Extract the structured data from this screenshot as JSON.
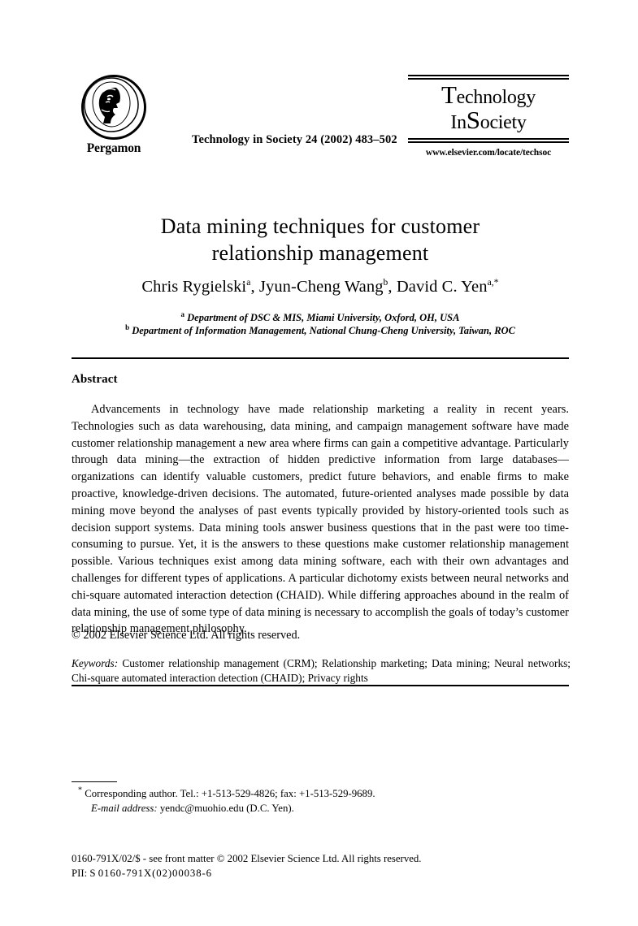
{
  "masthead": {
    "publisher_logo_text": "Pergamon",
    "publisher_logo_icon": "pergamon-medallion-icon",
    "journal_reference": "Technology in Society 24 (2002) 483–502",
    "journal_logo_line1_cap": "T",
    "journal_logo_line1_rest": "echnology",
    "journal_logo_line2_pre": "In",
    "journal_logo_line2_cap": "S",
    "journal_logo_line2_rest": "ociety",
    "journal_url": "www.elsevier.com/locate/techsoc"
  },
  "article": {
    "title_line1": "Data mining techniques for customer",
    "title_line2": "relationship management",
    "authors": "Chris Rygielski a, Jyun-Cheng Wang b, David C. Yen a,*",
    "author_list": [
      {
        "name": "Chris Rygielski",
        "marker": "a"
      },
      {
        "name": "Jyun-Cheng Wang",
        "marker": "b"
      },
      {
        "name": "David C. Yen",
        "marker": "a,*"
      }
    ],
    "affiliations": [
      {
        "marker": "a",
        "text": "Department of DSC & MIS, Miami University, Oxford, OH, USA"
      },
      {
        "marker": "b",
        "text": "Department of Information Management, National Chung-Cheng University, Taiwan, ROC"
      }
    ]
  },
  "abstract": {
    "heading": "Abstract",
    "body": "Advancements in technology have made relationship marketing a reality in recent years. Technologies such as data warehousing, data mining, and campaign management software have made customer relationship management a new area where firms can gain a competitive advantage. Particularly through data mining—the extraction of hidden predictive information from large databases—organizations can identify valuable customers, predict future behaviors, and enable firms to make proactive, knowledge-driven decisions. The automated, future-oriented analyses made possible by data mining move beyond the analyses of past events typically provided by history-oriented tools such as decision support systems. Data mining tools answer business questions that in the past were too time-consuming to pursue. Yet, it is the answers to these questions make customer relationship management possible. Various techniques exist among data mining software, each with their own advantages and challenges for different types of applications. A particular dichotomy exists between neural networks and chi-square automated interaction detection (CHAID). While differing approaches abound in the realm of data mining, the use of some type of data mining is necessary to accomplish the goals of today’s customer relationship management philosophy.",
    "copyright": "© 2002 Elsevier Science Ltd. All rights reserved."
  },
  "keywords": {
    "label": "Keywords:",
    "text": "Customer relationship management (CRM); Relationship marketing; Data mining; Neural networks; Chi-square automated interaction detection (CHAID); Privacy rights",
    "items": [
      "Customer relationship management (CRM)",
      "Relationship marketing",
      "Data mining",
      "Neural networks",
      "Chi-square automated interaction detection (CHAID)",
      "Privacy rights"
    ]
  },
  "footnote": {
    "marker": "*",
    "corresponding": "Corresponding author. Tel.: +1-513-529-4826; fax: +1-513-529-9689.",
    "email_label": "E-mail address:",
    "email_value": "yendc@muohio.edu (D.C. Yen)."
  },
  "imprint": {
    "line1": "0160-791X/02/$ - see front matter © 2002 Elsevier Science Ltd. All rights reserved.",
    "pii_label": "PII: S",
    "pii_value": "0160-791X(02)00038-6"
  }
}
